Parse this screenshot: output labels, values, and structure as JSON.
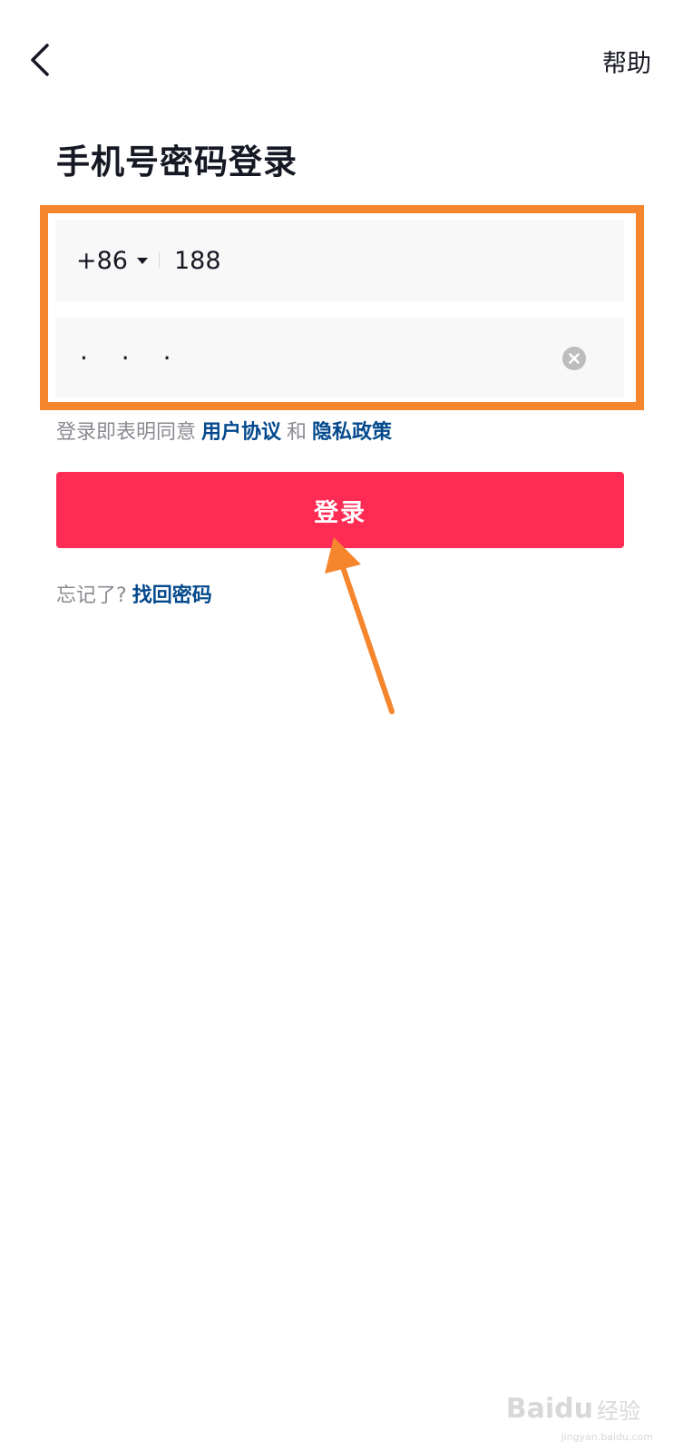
{
  "header": {
    "help_label": "帮助"
  },
  "page": {
    "title": "手机号密码登录"
  },
  "phone_field": {
    "country_code": "+86",
    "value": "188"
  },
  "password_field": {
    "value": "· · ·"
  },
  "agreement": {
    "prefix": "登录即表明同意",
    "user_agreement": "用户协议",
    "conjunction": "和",
    "privacy_policy": "隐私政策"
  },
  "login_button": {
    "label": "登录"
  },
  "forgot": {
    "prefix": "忘记了?",
    "link": "找回密码"
  },
  "watermark": {
    "logo": "Baidu",
    "text": "经验",
    "url": "jingyan.baidu.com"
  },
  "colors": {
    "primary": "#FE2C55",
    "link": "#04498D",
    "annotation": "#F5862E"
  }
}
